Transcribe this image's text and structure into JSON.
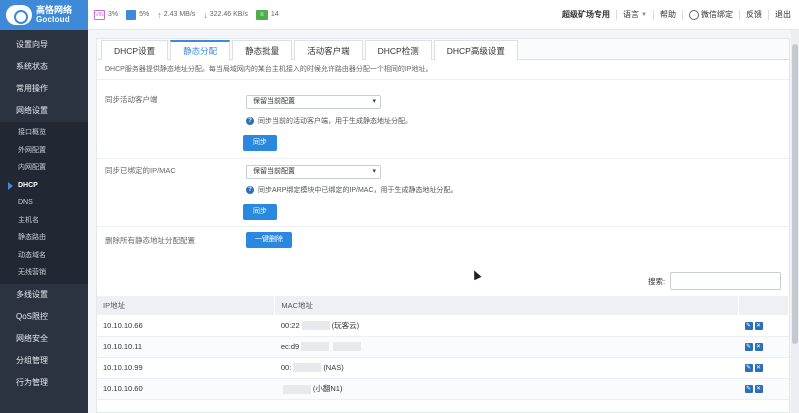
{
  "brand": {
    "name_cn": "高恪网络",
    "name_en": "Gocloud"
  },
  "topbar": {
    "cpu_badge": "VIN",
    "cpu": "3%",
    "mem": "5%",
    "upload": "2.43 MB/s",
    "download": "322.46 KB/s",
    "dev_badge": "≡",
    "devices": "14",
    "links": [
      "超级矿场专用",
      "语言",
      "帮助",
      "微信绑定",
      "反馈",
      "退出"
    ]
  },
  "sidebar": {
    "items_top": [
      "设置向导",
      "系统状态",
      "常用操作",
      "网络设置"
    ],
    "sub_items": [
      "接口概览",
      "外网配置",
      "内网配置",
      "DHCP",
      "DNS",
      "主机名",
      "静态路由",
      "动态域名",
      "无线营销"
    ],
    "items_bottom": [
      "多线设置",
      "QoS限控",
      "网络安全",
      "分组管理",
      "行为管理"
    ]
  },
  "tabs": [
    "DHCP设置",
    "静态分配",
    "静态批量",
    "活动客户端",
    "DHCP检测",
    "DHCP高级设置"
  ],
  "description": "DHCP服务器提供静态地址分配。每当局域网内的某台主机接入的时候允许路由器分配一个相同的IP地址。",
  "form": {
    "sync_active_label": "同步活动客户端",
    "sync_active_select": "保留当前配置",
    "sync_active_hint": "同步当前的活动客户端，用于生成静态地址分配。",
    "sync_button": "同步",
    "sync_bound_label": "同步已绑定的IP/MAC",
    "sync_bound_select": "保留当前配置",
    "sync_bound_hint": "同步ARP绑定模块中已绑定的IP/MAC，用于生成静态地址分配。",
    "sync_button_2": "同步",
    "delete_all_label": "删除所有静态地址分配配置",
    "delete_all_button": "一键删除"
  },
  "table": {
    "search_label": "搜索:",
    "search_value": "",
    "columns": [
      "IP地址",
      "MAC地址",
      ""
    ],
    "rows": [
      {
        "ip": "10.10.10.66",
        "mac_prefix": "00:22",
        "mac_suffix": "(玩客云)"
      },
      {
        "ip": "10.10.10.11",
        "mac_prefix": "ec:d9",
        "mac_suffix": ""
      },
      {
        "ip": "10.10.10.99",
        "mac_prefix": "00:",
        "mac_suffix": "(NAS)"
      },
      {
        "ip": "10.10.10.60",
        "mac_prefix": "",
        "mac_suffix": "(小翻N1)"
      }
    ]
  }
}
